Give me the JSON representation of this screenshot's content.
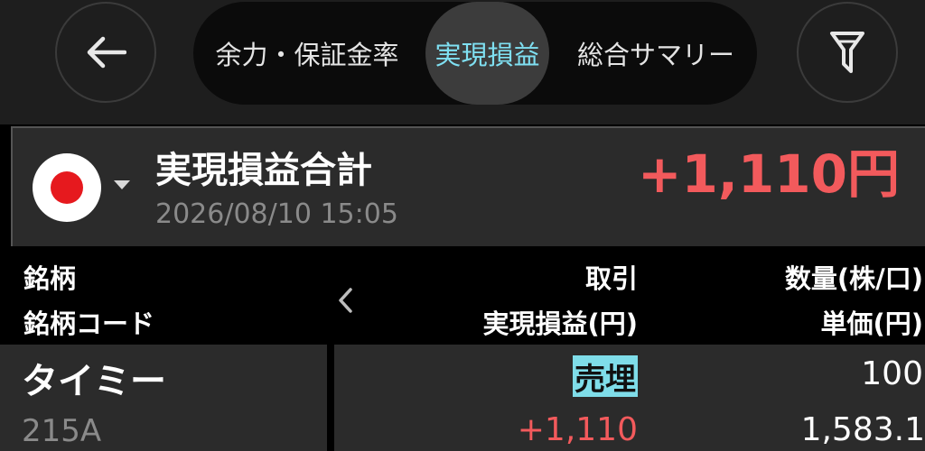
{
  "nav": {
    "back_icon": "arrow-left-icon",
    "filter_icon": "filter-icon",
    "tabs": [
      {
        "label": "余力・保証金率",
        "active": false
      },
      {
        "label": "実現損益",
        "active": true
      },
      {
        "label": "総合サマリー",
        "active": false
      }
    ]
  },
  "summary": {
    "market_flag_icon": "japan-flag-icon",
    "title": "実現損益合計",
    "datetime": "2026/08/10 15:05",
    "total": "+1,110円"
  },
  "columns": {
    "name": "銘柄",
    "code": "銘柄コード",
    "trade": "取引",
    "pnl": "実現損益(円)",
    "qty": "数量(株/口)",
    "price": "単価(円)"
  },
  "rows": [
    {
      "name": "タイミー",
      "code": "215A",
      "trade": "売埋",
      "pnl": "+1,110",
      "qty": "100",
      "price": "1,583.1"
    }
  ],
  "colors": {
    "accent": "#7fe0f2",
    "profit": "#f25a5c",
    "panel": "#2b2b2b",
    "background": "#000000"
  }
}
